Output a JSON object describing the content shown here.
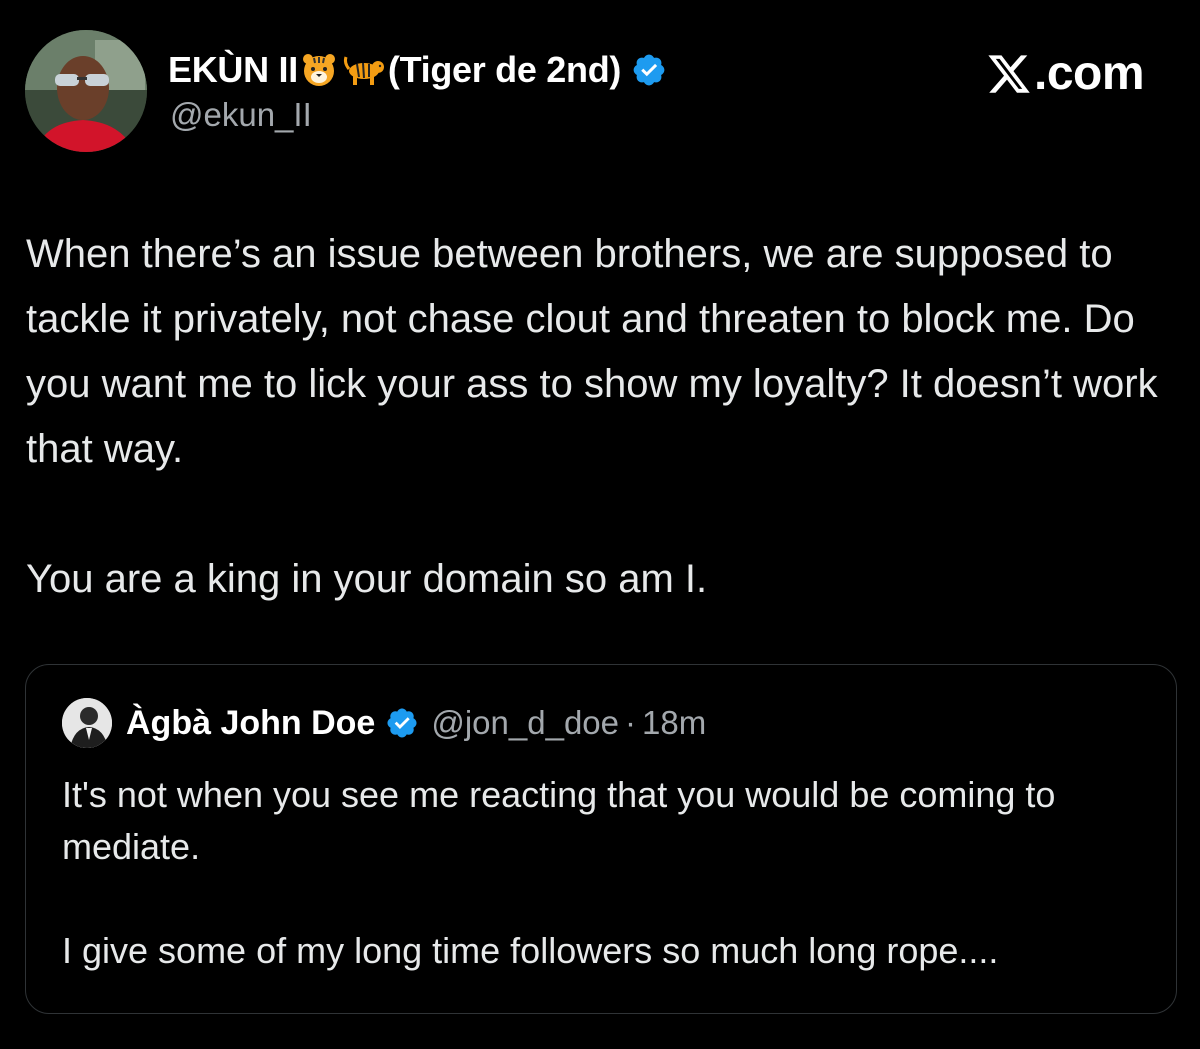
{
  "author": {
    "display_name": "EKÙN II",
    "display_name_suffix": "(Tiger de 2nd)",
    "handle": "@ekun_II",
    "emoji_icons": [
      "tiger-face-icon",
      "tiger-icon"
    ],
    "verified": true
  },
  "branding": {
    "site_label": ".com",
    "logo_icon": "x-logo-icon"
  },
  "tweet": {
    "paragraphs": [
      "When there’s an issue between brothers, we are supposed to tackle it privately, not chase clout and threaten to block me. Do you want me to lick your ass to show my loyalty? It doesn’t work that way.",
      "You are a king in your domain so am I."
    ]
  },
  "quoted_tweet": {
    "display_name": "Àgbà John Doe",
    "handle": "@jon_d_doe",
    "separator": "·",
    "time": "18m",
    "verified": true,
    "paragraphs": [
      "It's not when you see me reacting that you would be coming to mediate.",
      "I give some of my long time followers so much long rope...."
    ]
  },
  "colors": {
    "background": "#000000",
    "primary_text": "#e7e9ea",
    "secondary_text": "#a3a8ad",
    "verified_blue": "#1d9bf0",
    "card_border": "#2f3336"
  }
}
